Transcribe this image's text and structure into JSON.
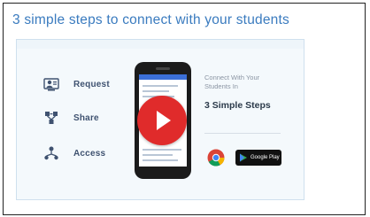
{
  "headline": "3 simple steps to connect with your students",
  "steps": [
    {
      "label": "Request",
      "icon": "user-request-icon"
    },
    {
      "label": "Share",
      "icon": "share-network-icon"
    },
    {
      "label": "Access",
      "icon": "access-nodes-icon"
    }
  ],
  "video": {
    "play_icon": "play-icon"
  },
  "aside": {
    "small_line1": "Connect With Your",
    "small_line2": "Students In",
    "big_text": "3 Simple Steps"
  },
  "badges": {
    "chrome_icon": "chrome-icon",
    "google_play_label": "Google Play"
  },
  "colors": {
    "headline": "#3a7bbf",
    "play_button": "#e02b2b",
    "card_background": "#f4f9fc"
  }
}
